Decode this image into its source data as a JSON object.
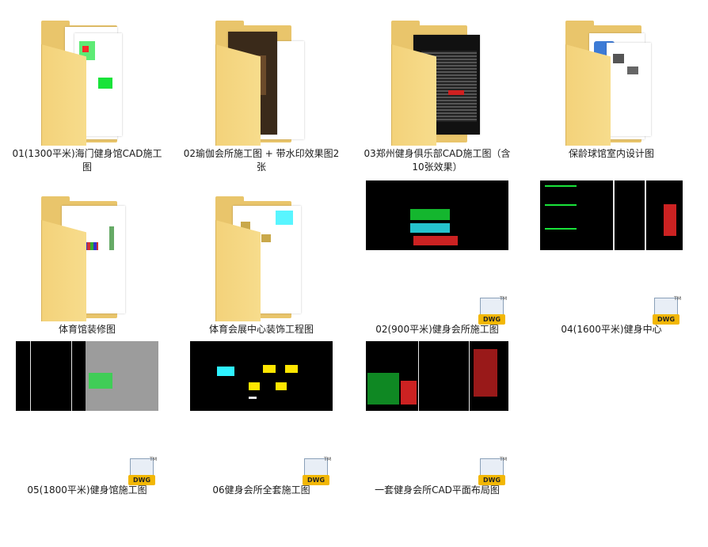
{
  "items": [
    {
      "label": "01(1300平米)海门健身馆CAD施工图",
      "type": "folder"
    },
    {
      "label": "02瑜伽会所施工图 + 带水印效果图2张",
      "type": "folder"
    },
    {
      "label": "03郑州健身俱乐部CAD施工图（含10张效果）",
      "type": "folder"
    },
    {
      "label": "保龄球馆室内设计图",
      "type": "folder"
    },
    {
      "label": "体育馆装修图",
      "type": "folder"
    },
    {
      "label": "体育会展中心装饰工程图",
      "type": "folder"
    },
    {
      "label": "02(900平米)健身会所施工图",
      "type": "dwg"
    },
    {
      "label": "04(1600平米)健身中心",
      "type": "dwg"
    },
    {
      "label": "05(1800平米)健身馆施工图",
      "type": "dwg"
    },
    {
      "label": "06健身会所全套施工图",
      "type": "dwg"
    },
    {
      "label": "一套健身会所CAD平面布局图",
      "type": "dwg"
    }
  ],
  "badge": {
    "text": "DWG",
    "tm": "TM"
  },
  "colors": {
    "folder": "#e9c56b",
    "cad_bg": "#000000",
    "badge": "#f2b705"
  }
}
